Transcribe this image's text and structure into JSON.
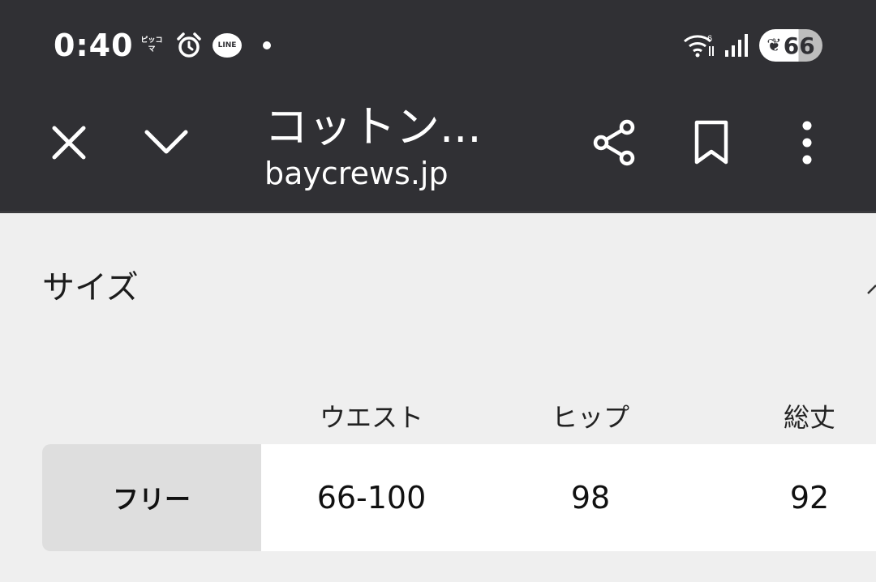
{
  "status_bar": {
    "time": "0:40",
    "notification_piccoma": "ピッコマ",
    "notification_line": "LINE",
    "battery_level": "66"
  },
  "browser": {
    "title": "コットン...",
    "url": "baycrews.jp"
  },
  "size_section": {
    "title": "サイズ",
    "columns": [
      "ウエスト",
      "ヒップ",
      "総丈"
    ],
    "rows": [
      {
        "label": "フリー",
        "values": [
          "66-100",
          "98",
          "92"
        ]
      }
    ]
  },
  "colors": {
    "toolbar_bg": "#303034",
    "page_bg": "#efefef",
    "row_label_bg": "#dedede"
  }
}
